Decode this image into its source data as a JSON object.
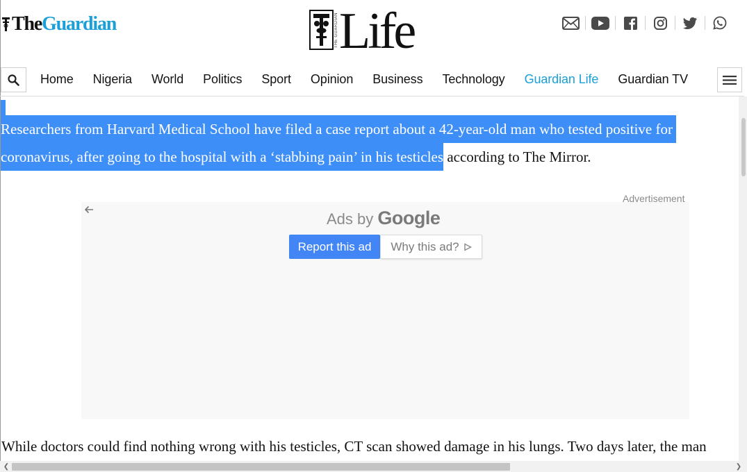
{
  "header": {
    "site_logo": {
      "part1": "The",
      "part2": "Guardian"
    },
    "section_logo": {
      "word": "Life",
      "side_text": "THE GUARDIAN"
    },
    "social_icons": [
      "mail-icon",
      "youtube-icon",
      "facebook-icon",
      "instagram-icon",
      "twitter-icon",
      "whatsapp-icon"
    ]
  },
  "nav": {
    "items": [
      {
        "label": "Home"
      },
      {
        "label": "Nigeria"
      },
      {
        "label": "World"
      },
      {
        "label": "Politics"
      },
      {
        "label": "Sport"
      },
      {
        "label": "Opinion"
      },
      {
        "label": "Business"
      },
      {
        "label": "Technology"
      },
      {
        "label": "Guardian Life"
      },
      {
        "label": "Guardian TV"
      }
    ],
    "active_index": 8
  },
  "article": {
    "para1_line1": "Researchers from Harvard Medical School have filed a case report about a 42-year-old man who tested positive for",
    "para1_line2_selected": "coronavirus, after going to the hospital with a ‘stabbing pain’ in his testicles",
    "para1_line2_rest": " according to The Mirror.",
    "para2": "While doctors could find nothing wrong with his testicles, CT scan showed damage in his lungs. Two days later, the man"
  },
  "ad": {
    "label": "Advertisement",
    "ads_by": "Ads by ",
    "google": "Google",
    "report_label": "Report this ad",
    "why_label": "Why this ad?"
  },
  "colors": {
    "accent": "#1a9fd9",
    "selection": "#3e8ef7",
    "ad_button": "#4285f4"
  }
}
